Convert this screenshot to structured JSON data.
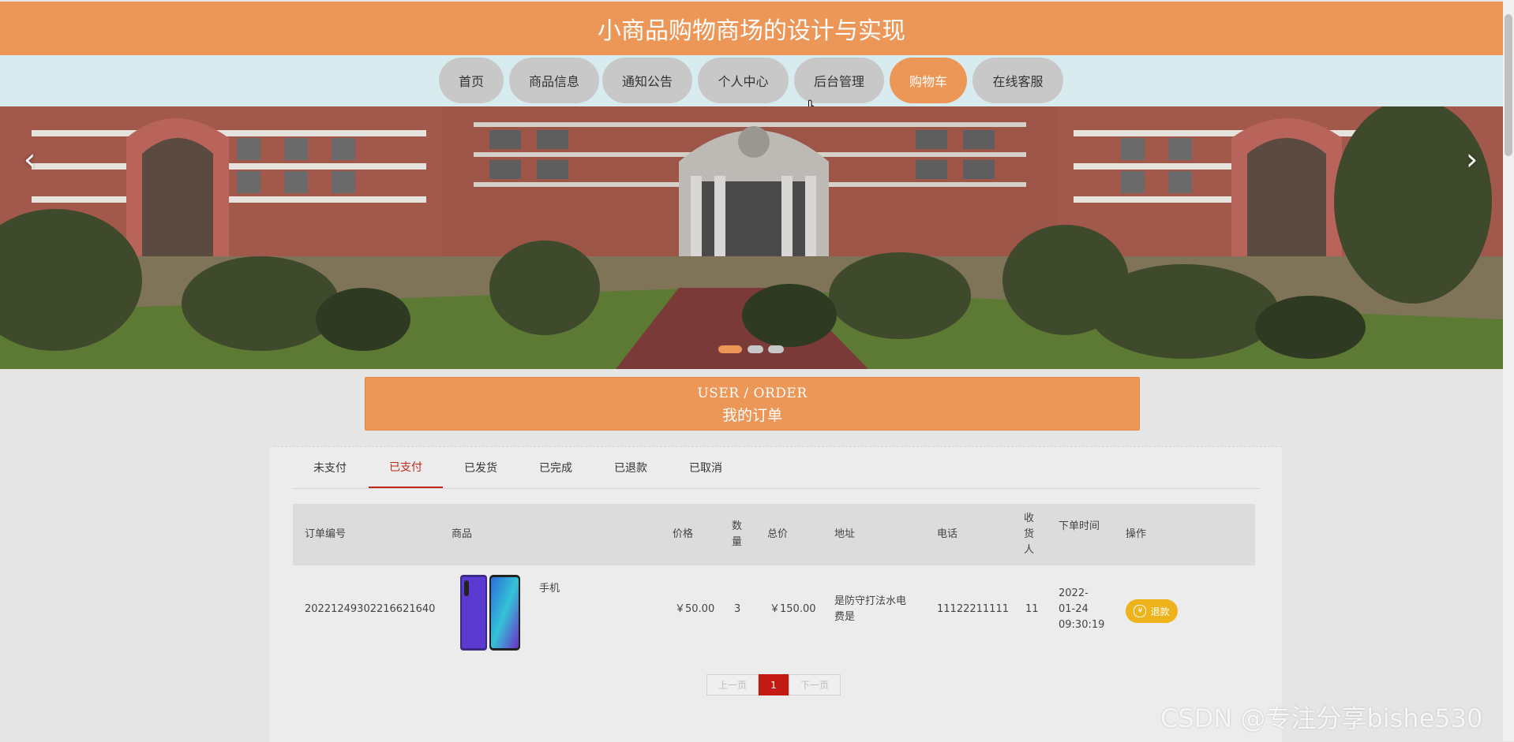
{
  "header": {
    "title": "小商品购物商场的设计与实现"
  },
  "nav": {
    "items": [
      {
        "label": "首页"
      },
      {
        "label": "商品信息"
      },
      {
        "label": "通知公告"
      },
      {
        "label": "个人中心"
      },
      {
        "label": "后台管理"
      },
      {
        "label": "购物车"
      },
      {
        "label": "在线客服"
      }
    ],
    "active": "购物车"
  },
  "banner": {
    "prev_icon": "‹",
    "next_icon": "›",
    "slide_count": 3,
    "active_slide": 1
  },
  "section": {
    "title_en": "USER / ORDER",
    "title_cn": "我的订单"
  },
  "tabs": {
    "items": [
      {
        "label": "未支付"
      },
      {
        "label": "已支付"
      },
      {
        "label": "已发货"
      },
      {
        "label": "已完成"
      },
      {
        "label": "已退款"
      },
      {
        "label": "已取消"
      }
    ],
    "active": "已支付"
  },
  "table": {
    "columns": [
      {
        "label": "订单编号"
      },
      {
        "label": "商品"
      },
      {
        "label": "价格"
      },
      {
        "label": "数量"
      },
      {
        "label": "总价"
      },
      {
        "label": "地址"
      },
      {
        "label": "电话"
      },
      {
        "label": "收货人"
      },
      {
        "label": "下单时间"
      },
      {
        "label": "操作"
      }
    ],
    "rows": [
      {
        "order_no": "20221249302216621640",
        "product_name": "手机",
        "price": "￥50.00",
        "quantity": "3",
        "total": "￥150.00",
        "address": "是防守打法水电费是",
        "phone": "11122211111",
        "receiver": "11",
        "order_time": "2022-01-24 09:30:19",
        "action_label": "退款",
        "action_icon": "yen-circle-icon"
      }
    ]
  },
  "pagination": {
    "prev_label": "上一页",
    "current_page": "1",
    "next_label": "下一页"
  },
  "watermark": {
    "text": "CSDN @专注分享bishe530"
  },
  "colors": {
    "accent": "#ec9657",
    "nav_background": "#d8ecef",
    "tab_active": "#c0271a",
    "refund_button": "#eeb31a",
    "pager_current": "#c41a14"
  }
}
